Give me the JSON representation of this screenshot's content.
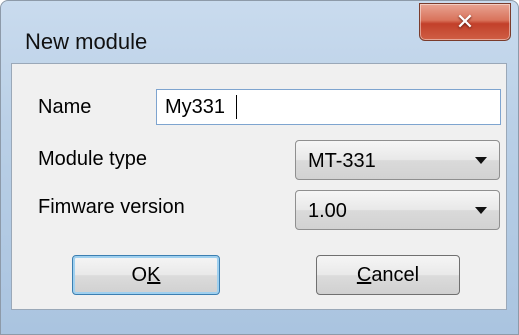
{
  "window": {
    "title": "New module",
    "close_icon": "close-icon",
    "colors": {
      "close_button": "#c7432d",
      "client_background": "#f0f0f0"
    }
  },
  "form": {
    "name_label": "Name",
    "name_value": "My331",
    "module_type_label": "Module type",
    "module_type_value": "MT-331",
    "firmware_label": "Fimware version",
    "firmware_value": "1.00"
  },
  "buttons": {
    "ok": {
      "label_before": "O",
      "label_mnemonic": "K",
      "label_after": ""
    },
    "cancel": {
      "label_before": "",
      "label_mnemonic": "C",
      "label_after": "ancel"
    }
  }
}
